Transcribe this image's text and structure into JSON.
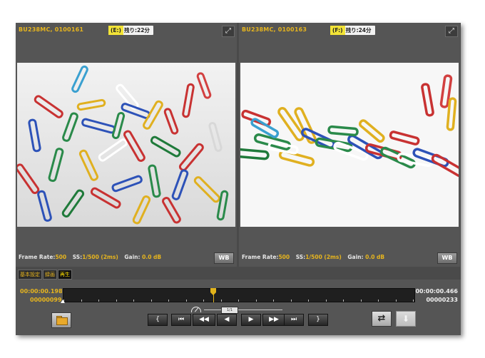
{
  "cameras": [
    {
      "id": "BU238MC, 0100161",
      "drive": "(E:)",
      "remaining": "残り:22分",
      "frame_rate_label": "Frame Rate:",
      "frame_rate": "500",
      "ss_label": "SS:",
      "ss": "1/500 (2ms)",
      "gain_label": "Gain:",
      "gain": "0.0 dB",
      "wb": "WB"
    },
    {
      "id": "BU238MC, 0100163",
      "drive": "(F:)",
      "remaining": "残り:24分",
      "frame_rate_label": "Frame Rate:",
      "frame_rate": "500",
      "ss_label": "SS:",
      "ss": "1/500 (2ms)",
      "gain_label": "Gain:",
      "gain": "0.0 dB",
      "wb": "WB"
    }
  ],
  "tabs": [
    {
      "label": "基本設定",
      "active": false
    },
    {
      "label": "録画",
      "active": false
    },
    {
      "label": "再生",
      "active": true
    }
  ],
  "timeline": {
    "start_time": "00:00:00.198",
    "start_frame": "00000099",
    "end_time": "00:00:00.466",
    "end_frame": "00000233",
    "playhead_fraction": 0.426
  },
  "speed_knob_label": "1/1",
  "transport": [
    {
      "name": "mark-in-button",
      "glyph": "{"
    },
    {
      "name": "first-frame-button",
      "glyph": "⏮"
    },
    {
      "name": "fast-rewind-button",
      "glyph": "◀◀"
    },
    {
      "name": "reverse-play-button",
      "glyph": "◀"
    },
    {
      "name": "play-button",
      "glyph": "▶"
    },
    {
      "name": "fast-forward-button",
      "glyph": "▶▶"
    },
    {
      "name": "last-frame-button",
      "glyph": "⏭"
    },
    {
      "name": "mark-out-button",
      "glyph": "}"
    }
  ],
  "colors": {
    "accent": "#e7b51e",
    "panel": "#555555",
    "app_bg": "#4a4a4a"
  }
}
